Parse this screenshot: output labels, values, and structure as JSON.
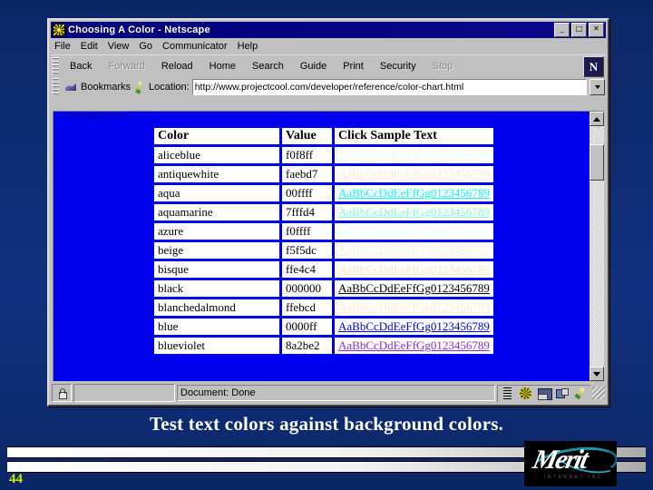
{
  "slide": {
    "caption": "Test text colors against background colors.",
    "page_number": "44",
    "background_color": "#0d2a6b",
    "logo": {
      "wordmark": "Merit",
      "subtext": "INTERNET INC"
    }
  },
  "browser": {
    "title": "Choosing A Color - Netscape",
    "title_icon": "netscape-page-icon",
    "window_buttons": {
      "minimize": "_",
      "maximize": "□",
      "close": "✕"
    },
    "menu": [
      "File",
      "Edit",
      "View",
      "Go",
      "Communicator",
      "Help"
    ],
    "toolbar": [
      {
        "label": "Back",
        "enabled": true
      },
      {
        "label": "Forward",
        "enabled": false
      },
      {
        "label": "Reload",
        "enabled": true
      },
      {
        "label": "Home",
        "enabled": true
      },
      {
        "label": "Search",
        "enabled": true
      },
      {
        "label": "Guide",
        "enabled": true
      },
      {
        "label": "Print",
        "enabled": true
      },
      {
        "label": "Security",
        "enabled": true
      },
      {
        "label": "Stop",
        "enabled": false
      }
    ],
    "brand_button": "N",
    "location": {
      "bookmarks_label": "Bookmarks",
      "location_label": "Location:",
      "url": "http://www.projectcool.com/developer/reference/color-chart.html"
    },
    "status": {
      "message": "Document: Done"
    }
  },
  "page": {
    "background_color": "#0000ee",
    "clipped_text": "you want to use.",
    "table": {
      "headers": [
        "Color",
        "Value",
        "Click Sample Text"
      ],
      "sample_text": "AaBbCcDdEeFfGg0123456789",
      "rows": [
        {
          "name": "aliceblue",
          "value": "f0f8ff",
          "hex": "#f0f8ff"
        },
        {
          "name": "antiquewhite",
          "value": "faebd7",
          "hex": "#faebd7"
        },
        {
          "name": "aqua",
          "value": "00ffff",
          "hex": "#00ffff"
        },
        {
          "name": "aquamarine",
          "value": "7fffd4",
          "hex": "#7fffd4"
        },
        {
          "name": "azure",
          "value": "f0ffff",
          "hex": "#f0ffff"
        },
        {
          "name": "beige",
          "value": "f5f5dc",
          "hex": "#f5f5dc"
        },
        {
          "name": "bisque",
          "value": "ffe4c4",
          "hex": "#ffe4c4"
        },
        {
          "name": "black",
          "value": "000000",
          "hex": "#000000"
        },
        {
          "name": "blanchedalmond",
          "value": "ffebcd",
          "hex": "#ffebcd"
        },
        {
          "name": "blue",
          "value": "0000ff",
          "hex": "#0000ff"
        },
        {
          "name": "blueviolet",
          "value": "8a2be2",
          "hex": "#8a2be2"
        }
      ]
    }
  }
}
